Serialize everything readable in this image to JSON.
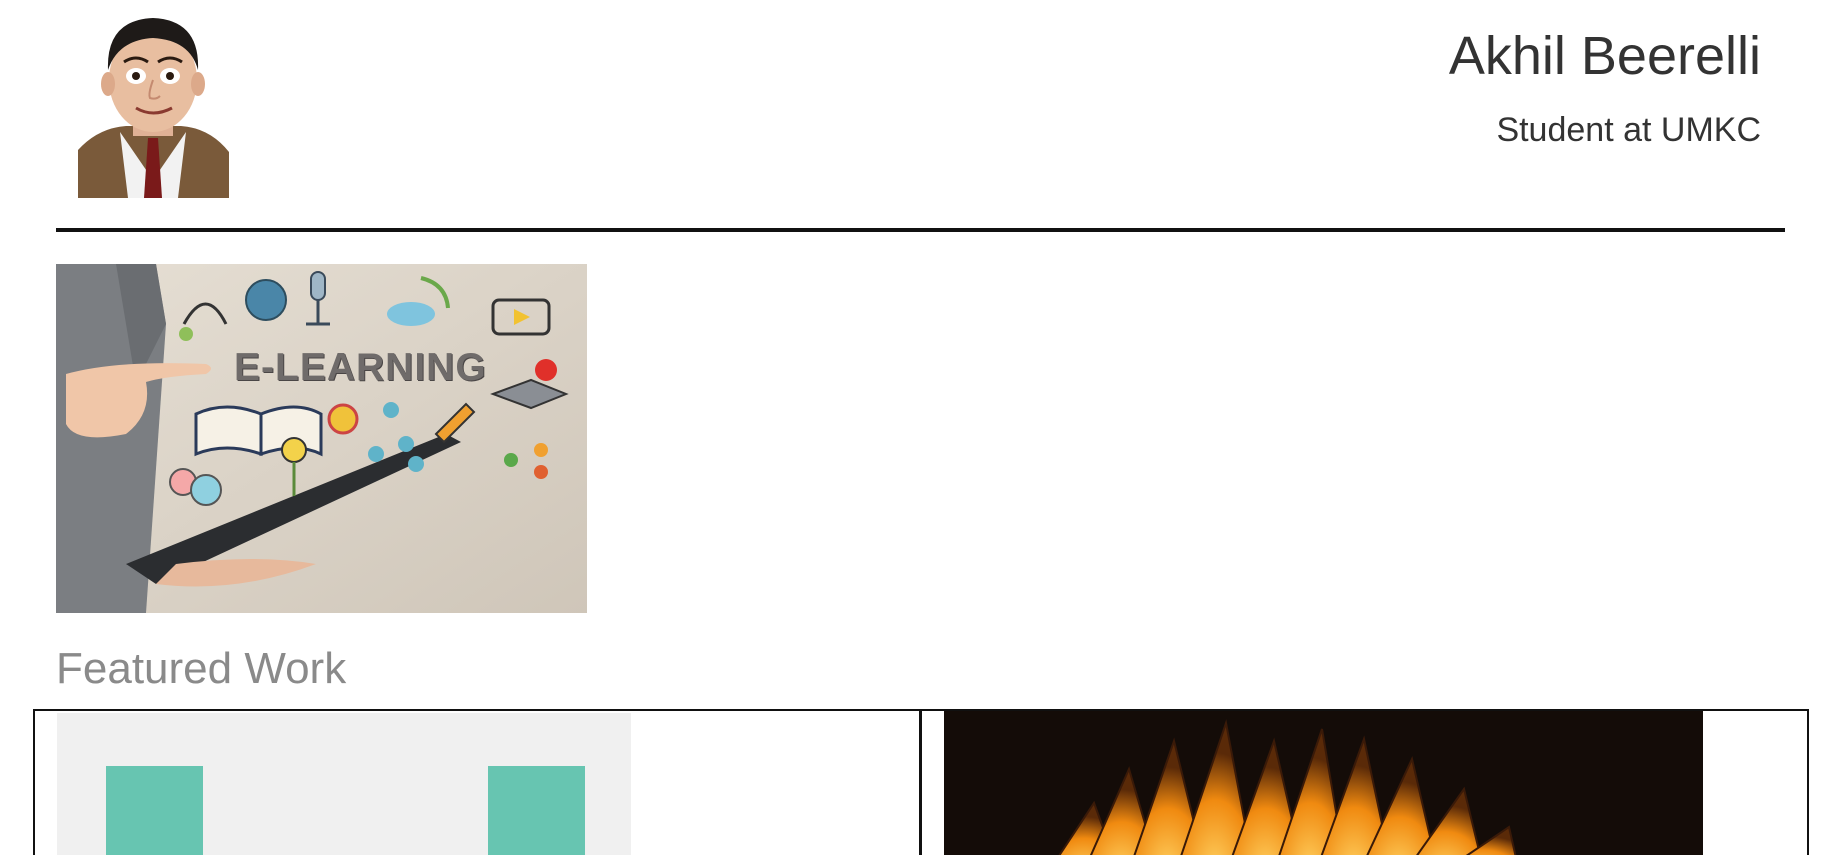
{
  "header": {
    "name": "Akhil Beerelli",
    "subtitle": "Student at UMKC"
  },
  "hero": {
    "image_text": "E-LEARNING"
  },
  "featured": {
    "title": "Featured Work"
  },
  "colors": {
    "rule": "#111111",
    "teal": "#67c5b1",
    "heading_grey": "#8a8a8a"
  }
}
